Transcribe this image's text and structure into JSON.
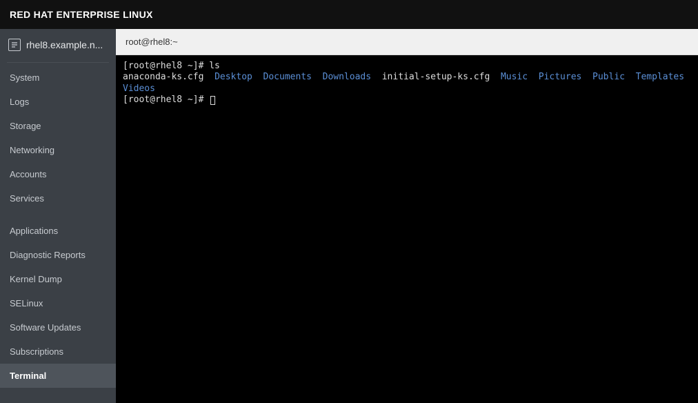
{
  "topbar": {
    "title": "RED HAT ENTERPRISE LINUX"
  },
  "sidebar": {
    "host_label": "rhel8.example.n...",
    "group1": [
      {
        "label": "System"
      },
      {
        "label": "Logs"
      },
      {
        "label": "Storage"
      },
      {
        "label": "Networking"
      },
      {
        "label": "Accounts"
      },
      {
        "label": "Services"
      }
    ],
    "group2": [
      {
        "label": "Applications"
      },
      {
        "label": "Diagnostic Reports"
      },
      {
        "label": "Kernel Dump"
      },
      {
        "label": "SELinux"
      },
      {
        "label": "Software Updates"
      },
      {
        "label": "Subscriptions"
      },
      {
        "label": "Terminal"
      }
    ]
  },
  "terminal": {
    "title": "root@rhel8:~",
    "prompt1": "[root@rhel8 ~]# ",
    "cmd1": "ls",
    "ls_entries": [
      {
        "name": "anaconda-ks.cfg",
        "type": "file"
      },
      {
        "name": "Desktop",
        "type": "dir"
      },
      {
        "name": "Documents",
        "type": "dir"
      },
      {
        "name": "Downloads",
        "type": "dir"
      },
      {
        "name": "initial-setup-ks.cfg",
        "type": "file"
      },
      {
        "name": "Music",
        "type": "dir"
      },
      {
        "name": "Pictures",
        "type": "dir"
      },
      {
        "name": "Public",
        "type": "dir"
      },
      {
        "name": "Templates",
        "type": "dir"
      },
      {
        "name": "Videos",
        "type": "dir"
      }
    ],
    "prompt2": "[root@rhel8 ~]# "
  }
}
